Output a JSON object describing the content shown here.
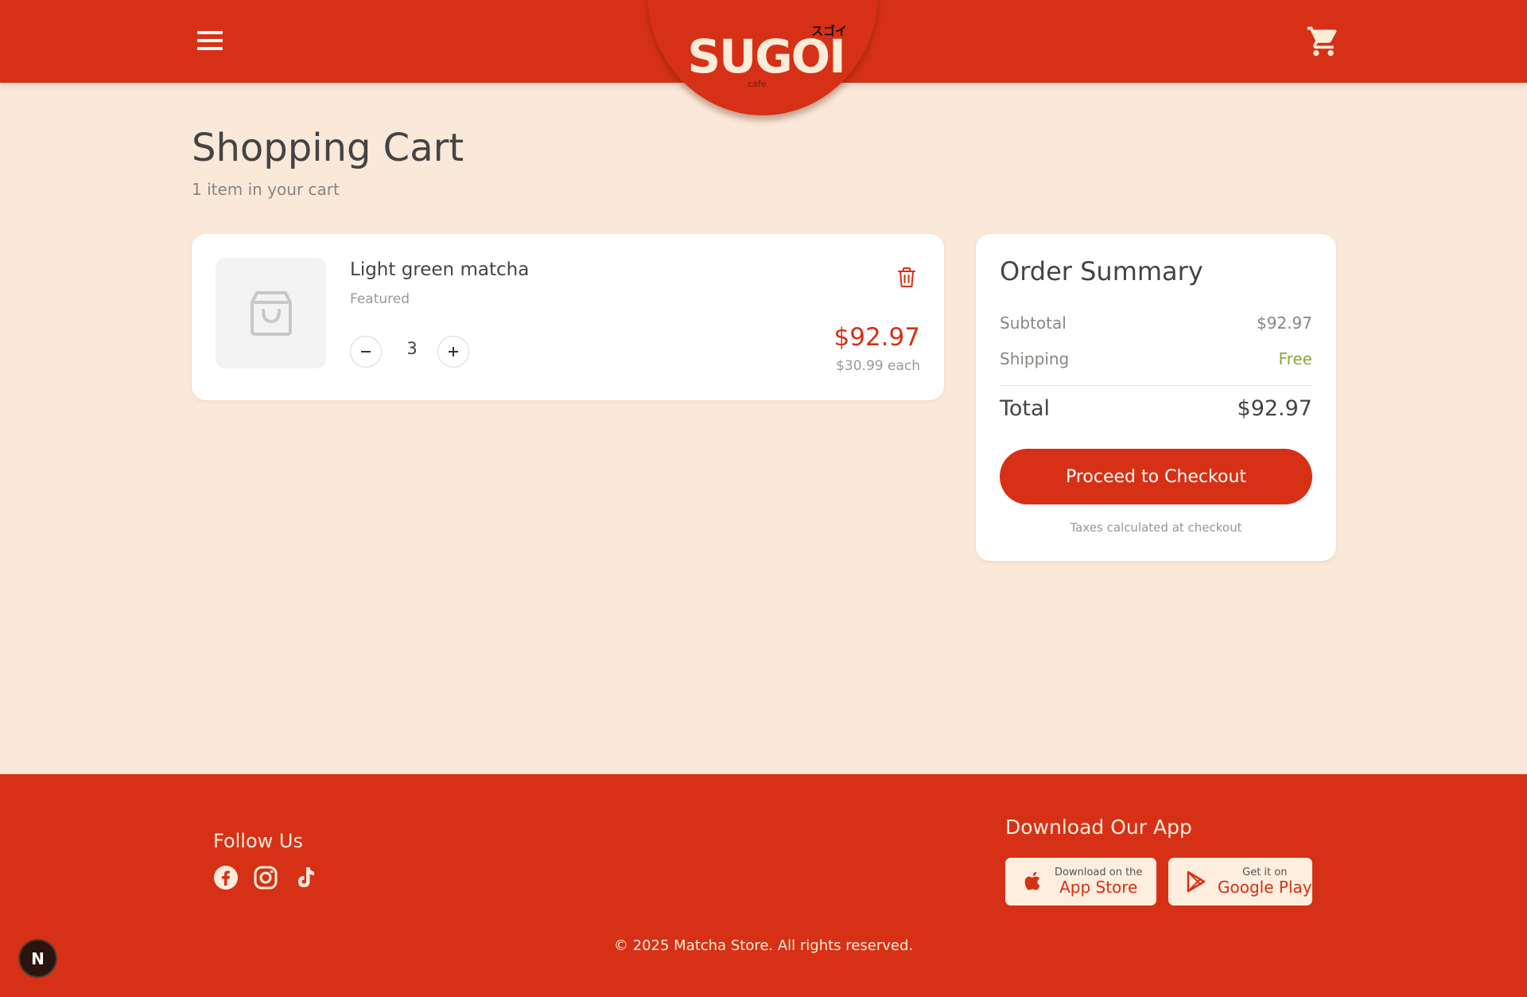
{
  "header": {
    "logo_text": "SUGOI",
    "logo_kana": "スゴイ",
    "logo_sub": "cafe"
  },
  "page": {
    "title": "Shopping Cart",
    "subtitle": "1 item in your cart"
  },
  "cart": {
    "items": [
      {
        "name": "Light green matcha",
        "category": "Featured",
        "quantity": "3",
        "line_total": "$92.97",
        "unit_price": "$30.99 each"
      }
    ]
  },
  "summary": {
    "title": "Order Summary",
    "subtotal_label": "Subtotal",
    "subtotal_value": "$92.97",
    "shipping_label": "Shipping",
    "shipping_value": "Free",
    "total_label": "Total",
    "total_value": "$92.97",
    "checkout_label": "Proceed to Checkout",
    "tax_note": "Taxes calculated at checkout"
  },
  "footer": {
    "follow_title": "Follow Us",
    "social": [
      "facebook-icon",
      "instagram-icon",
      "tiktok-icon"
    ],
    "app_title": "Download Our App",
    "app_store_small": "Download on the",
    "app_store_big": "App Store",
    "google_small": "Get it on",
    "google_big": "Google Play",
    "copyright": "© 2025 Matcha Store. All rights reserved."
  },
  "dev_badge": "N",
  "colors": {
    "brand_red": "#d63116",
    "page_bg": "#fae8d8",
    "cream": "#fbecd9",
    "free_green": "#8aa83a"
  }
}
